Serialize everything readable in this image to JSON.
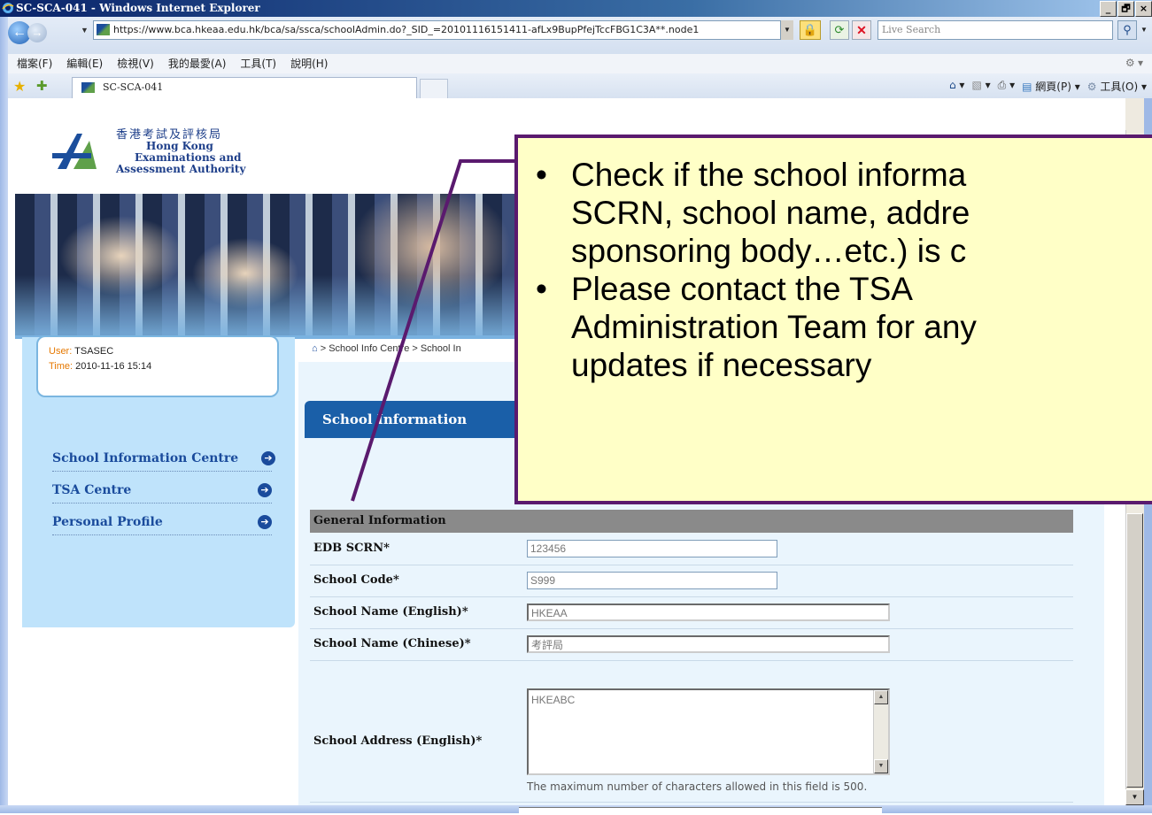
{
  "window": {
    "title": "SC-SCA-041 - Windows Internet Explorer",
    "controls": [
      "_",
      "🗗",
      "×"
    ]
  },
  "address_bar": {
    "url": "https://www.bca.hkeaa.edu.hk/bca/sa/ssca/schoolAdmin.do?_SID_=20101116151411-afLx9BupPfejTccFBG1C3A**.node1",
    "search_placeholder": "Live Search"
  },
  "menu": [
    "檔案(F)",
    "編輯(E)",
    "檢視(V)",
    "我的最愛(A)",
    "工具(T)",
    "說明(H)"
  ],
  "tab": {
    "title": "SC-SCA-041",
    "commands": [
      "▾",
      "▾",
      "▾",
      "網頁(P) ▾",
      "工具(O) ▾"
    ]
  },
  "logo": {
    "chinese": "香港考試及評核局",
    "english_line1": "Hong Kong",
    "english_line2": "Examinations and",
    "english_line3": "Assessment Authority"
  },
  "user_box": {
    "user_label": "User:",
    "user_value": "TSASEC",
    "time_label": "Time:",
    "time_value": "2010-11-16 15:14"
  },
  "sidebar": {
    "items": [
      {
        "label": "School Information Centre"
      },
      {
        "label": "TSA Centre"
      },
      {
        "label": "Personal Profile"
      }
    ]
  },
  "breadcrumb": "> School Info Centre > School In",
  "section_title": "School Information",
  "form": {
    "group_header": "General Information",
    "fields": [
      {
        "label": "EDB SCRN*",
        "value": "123456"
      },
      {
        "label": "School Code*",
        "value": "S999"
      },
      {
        "label": "School Name (English)*",
        "value": "HKEAA"
      },
      {
        "label": "School Name (Chinese)*",
        "value": "考評局"
      },
      {
        "label": "School Address (English)*",
        "value": "HKEABC"
      }
    ],
    "address_hint": "The maximum number of characters allowed in this field is 500."
  },
  "callout": {
    "bullet1_lines": [
      "Check if the school informa",
      "SCRN, school name, addre",
      "sponsoring body…etc.) is c"
    ],
    "bullet2_lines": [
      "Please contact the TSA",
      "Administration Team for any",
      "updates if necessary"
    ]
  },
  "colors": {
    "titlebar": "#0a246a",
    "nav_text": "#1a4b9c",
    "callout_bg": "#ffffc7",
    "callout_border": "#5a1a6e",
    "section_header": "#1a5fa8"
  }
}
